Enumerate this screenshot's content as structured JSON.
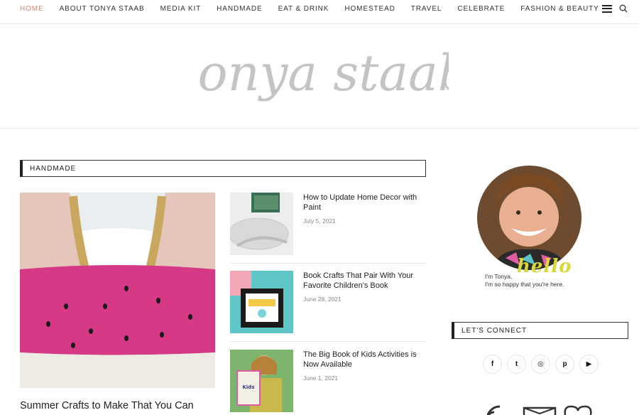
{
  "nav": {
    "items": [
      "HOME",
      "ABOUT TONYA STAAB",
      "MEDIA KIT",
      "HANDMADE",
      "EAT & DRINK",
      "HOMESTEAD",
      "TRAVEL",
      "CELEBRATE",
      "FASHION & BEAUTY"
    ],
    "active_index": 0,
    "menu_icon": "hamburger-menu-icon",
    "search_icon": "search-icon"
  },
  "logo": {
    "text": "tonya staab"
  },
  "handmade": {
    "heading": "HANDMADE",
    "feature": {
      "title": "Summer Crafts to Make That You Can"
    },
    "posts": [
      {
        "title": "How to Update Home Decor with Paint",
        "date": "July 5, 2021"
      },
      {
        "title": "Book Crafts That Pair With Your Favorite Children's Book",
        "date": "June 28, 2021"
      },
      {
        "title": "The Big Book of Kids Activities is Now Available",
        "date": "June 1, 2021"
      }
    ]
  },
  "sidebar": {
    "hello": "hello",
    "intro_line1": "I'm Tonya,",
    "intro_line2": "I'm so happy that you're here.",
    "connect_heading": "LET'S CONNECT",
    "socials": [
      {
        "icon": "facebook-icon",
        "glyph": "f"
      },
      {
        "icon": "twitter-icon",
        "glyph": "t"
      },
      {
        "icon": "instagram-icon",
        "glyph": "◎"
      },
      {
        "icon": "pinterest-icon",
        "glyph": "p"
      },
      {
        "icon": "youtube-icon",
        "glyph": "▶"
      }
    ]
  },
  "colors": {
    "accent": "#e0856b",
    "hello_yellow": "#d7d93a"
  }
}
